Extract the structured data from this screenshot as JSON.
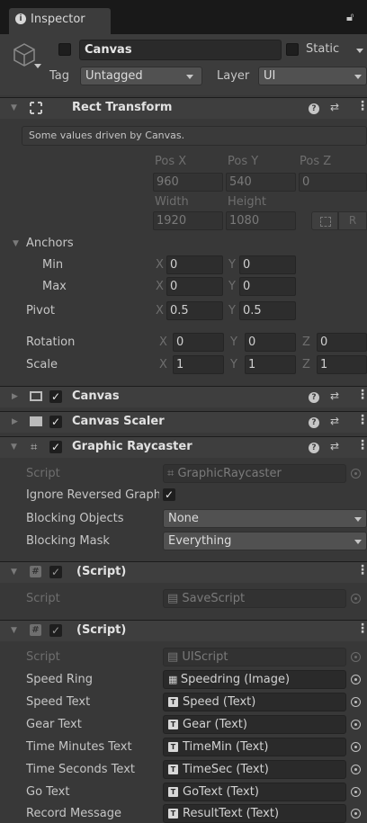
{
  "tab": {
    "title": "Inspector"
  },
  "gameobject": {
    "name": "Canvas",
    "static_label": "Static",
    "tag_label": "Tag",
    "tag_value": "Untagged",
    "layer_label": "Layer",
    "layer_value": "UI"
  },
  "rect_transform": {
    "title": "Rect Transform",
    "info": "Some values driven by Canvas.",
    "posx_label": "Pos X",
    "posy_label": "Pos Y",
    "posz_label": "Pos Z",
    "posx": "960",
    "posy": "540",
    "posz": "0",
    "width_label": "Width",
    "height_label": "Height",
    "width": "1920",
    "height": "1080",
    "r_button": "R",
    "anchors_label": "Anchors",
    "min_label": "Min",
    "max_label": "Max",
    "min_x": "0",
    "min_y": "0",
    "max_x": "0",
    "max_y": "0",
    "pivot_label": "Pivot",
    "pivot_x": "0.5",
    "pivot_y": "0.5",
    "rotation_label": "Rotation",
    "rot_x": "0",
    "rot_y": "0",
    "rot_z": "0",
    "scale_label": "Scale",
    "scale_x": "1",
    "scale_y": "1",
    "scale_z": "1",
    "axis_x": "X",
    "axis_y": "Y",
    "axis_z": "Z"
  },
  "components": {
    "canvas": "Canvas",
    "canvas_scaler": "Canvas Scaler",
    "graphic_raycaster": "Graphic Raycaster"
  },
  "raycaster": {
    "script_label": "Script",
    "script_value": "GraphicRaycaster",
    "ignore_label": "Ignore Reversed Graphics",
    "blocking_objects_label": "Blocking Objects",
    "blocking_objects_value": "None",
    "blocking_mask_label": "Blocking Mask",
    "blocking_mask_value": "Everything"
  },
  "save_script": {
    "title": "(Script)",
    "script_label": "Script",
    "script_value": "SaveScript"
  },
  "ui_script": {
    "title": "(Script)",
    "script_label": "Script",
    "script_value": "UIScript",
    "fields": [
      {
        "label": "Speed Ring",
        "value": "Speedring (Image)",
        "icon": "image-icon"
      },
      {
        "label": "Speed Text",
        "value": "Speed (Text)",
        "icon": "text-icon"
      },
      {
        "label": "Gear Text",
        "value": "Gear (Text)",
        "icon": "text-icon"
      },
      {
        "label": "Time Minutes Text",
        "value": "TimeMin (Text)",
        "icon": "text-icon"
      },
      {
        "label": "Time Seconds Text",
        "value": "TimeSec (Text)",
        "icon": "text-icon"
      },
      {
        "label": "Go Text",
        "value": "GoText (Text)",
        "icon": "text-icon"
      },
      {
        "label": "Record Message",
        "value": "ResultText (Text)",
        "icon": "text-icon"
      }
    ]
  },
  "colors": {
    "background": "#383838",
    "header": "#3e3e3e",
    "field": "#2a2a2a"
  }
}
